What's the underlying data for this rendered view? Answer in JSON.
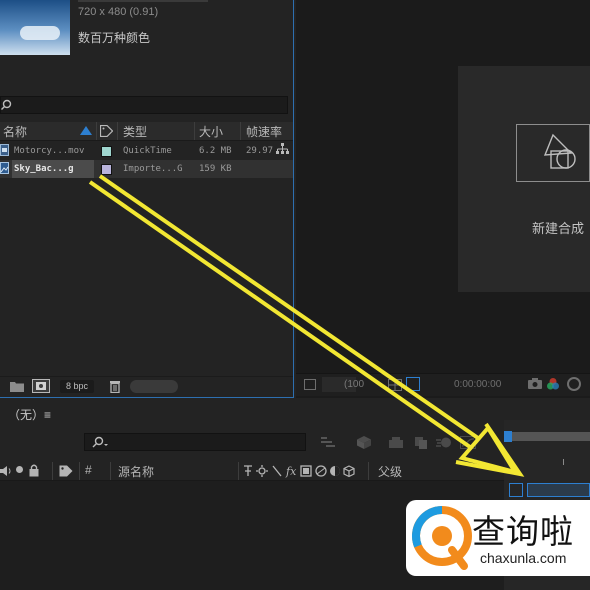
{
  "project": {
    "thumb_meta": "720 x 480 (0.91)",
    "thumb_colors": "数百万种颜色",
    "search_icon": "search-icon",
    "columns": {
      "name": "名称",
      "type": "类型",
      "size": "大小",
      "fps": "帧速率"
    },
    "files": [
      {
        "name": "Motorcy...mov",
        "type": "QuickTime",
        "size": "6.2 MB",
        "fps": "29.97",
        "label_color": "#9fd6cf"
      },
      {
        "name": "Sky_Bac...g",
        "type": "Importe...G",
        "size": "159 KB",
        "fps": "",
        "label_color": "#b9b4dc"
      }
    ],
    "footer": {
      "bpc": "8 bpc"
    }
  },
  "viewer": {
    "new_comp_label": "新建合成",
    "timecode": "0:00:00:00",
    "zoom": "(100"
  },
  "timeline": {
    "tab_label": "（无）≡",
    "header": {
      "hash": "#",
      "source_name": "源名称",
      "parent": "父级"
    }
  },
  "watermark": {
    "text": "查询啦",
    "url": "chaxunla.com"
  },
  "colors": {
    "accent": "#2d7fd0",
    "annotation_arrow": "#f2e733",
    "panel_bg": "#232323"
  }
}
